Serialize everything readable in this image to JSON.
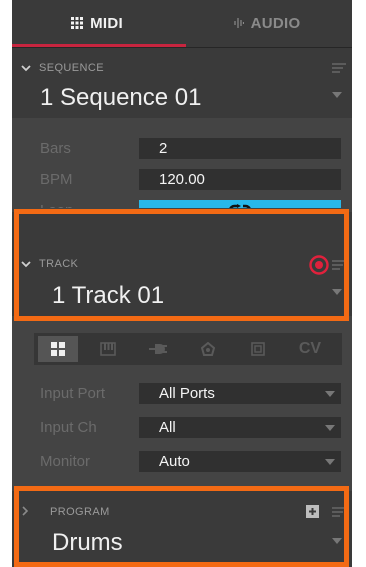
{
  "tabs": [
    {
      "label": "MIDI",
      "icon": "grid-icon",
      "active": true
    },
    {
      "label": "AUDIO",
      "icon": "waveform-icon",
      "active": false
    }
  ],
  "sequence": {
    "header": "SEQUENCE",
    "name": "1 Sequence 01",
    "bars_label": "Bars",
    "bars_value": "2",
    "bpm_label": "BPM",
    "bpm_value": "120.00",
    "loop_label": "Loop",
    "loop_icon": "loop-icon",
    "loop_color": "#28b8ea"
  },
  "track": {
    "header": "TRACK",
    "name": "1 Track 01",
    "record_icon": "record-arm-icon",
    "record_color": "#e0213c",
    "types": [
      "grid-icon",
      "keyboard-icon",
      "plug-icon",
      "drum-icon",
      "square-icon",
      "CV"
    ],
    "input_port_label": "Input Port",
    "input_port_value": "All Ports",
    "input_ch_label": "Input Ch",
    "input_ch_value": "All",
    "monitor_label": "Monitor",
    "monitor_value": "Auto"
  },
  "program": {
    "header": "PROGRAM",
    "name": "Drums",
    "add_icon": "plus-icon"
  },
  "highlight_color": "#f36a14",
  "accent_color": "#c8253f"
}
